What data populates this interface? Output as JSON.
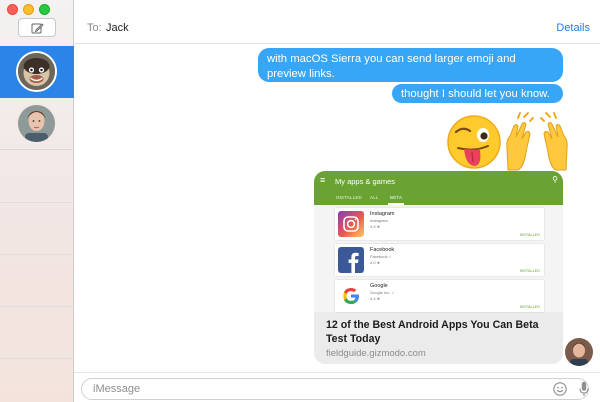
{
  "header": {
    "to_label": "To:",
    "recipient": "Jack",
    "details_label": "Details"
  },
  "conversations": [
    {
      "avatar": "monkey-avatar",
      "selected": true
    },
    {
      "avatar": "person-avatar",
      "selected": false
    }
  ],
  "messages": [
    {
      "text": "with macOS Sierra you can send larger emoji and preview links."
    },
    {
      "text": "thought I should let you know."
    }
  ],
  "emoji": [
    {
      "name": "winking-face-tongue-emoji"
    },
    {
      "name": "raising-hands-emoji"
    }
  ],
  "link_preview": {
    "screenshot": {
      "appbar_title": "My apps & games",
      "tabs": [
        "INSTALLED",
        "ALL",
        "BETA"
      ],
      "apps": [
        {
          "name": "Instagram",
          "developer": "Instagram",
          "rating": "4.5 ★",
          "status": "INSTALLED"
        },
        {
          "name": "Facebook",
          "developer": "Facebook ✓",
          "rating": "4.0 ★",
          "status": "INSTALLED"
        },
        {
          "name": "Google",
          "developer": "Google Inc. ✓",
          "rating": "4.4 ★",
          "status": "INSTALLED"
        }
      ]
    },
    "title": "12 of the Best Android Apps You Can Beta Test Today",
    "url": "fieldguide.gizmodo.com"
  },
  "composer": {
    "placeholder": "iMessage"
  },
  "colors": {
    "accent": "#2b84e8",
    "bubble": "#37a6f6",
    "android_green": "#6aa334"
  }
}
